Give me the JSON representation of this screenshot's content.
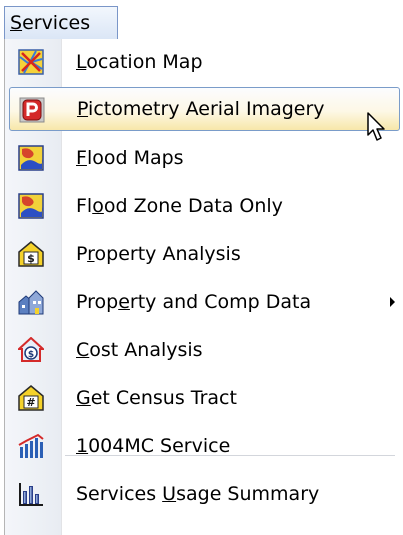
{
  "menubar": {
    "services_label": "Services",
    "mnemonic": "S",
    "rest": "ervices"
  },
  "menu": {
    "items": [
      {
        "id": "location-map",
        "label": "Location Map",
        "pre": "",
        "u": "L",
        "post": "ocation Map",
        "icon": "location-map-icon"
      },
      {
        "id": "pictometry",
        "label": "Pictometry Aerial Imagery",
        "pre": "",
        "u": "P",
        "post": "ictometry Aerial Imagery",
        "icon": "pictometry-p-icon",
        "highlighted": true
      },
      {
        "id": "flood-maps",
        "label": "Flood Maps",
        "pre": "",
        "u": "F",
        "post": "lood Maps",
        "icon": "flood-map-icon"
      },
      {
        "id": "flood-zone",
        "label": "Flood Zone Data Only",
        "pre": "Fl",
        "u": "o",
        "post": "od Zone Data Only",
        "icon": "flood-zone-icon"
      },
      {
        "id": "property-analysis",
        "label": "Property Analysis",
        "pre": "P",
        "u": "r",
        "post": "operty Analysis",
        "icon": "dollar-house-icon"
      },
      {
        "id": "property-comp",
        "label": "Property and Comp Data",
        "pre": "Prop",
        "u": "e",
        "post": "rty and Comp Data",
        "icon": "buildings-icon",
        "submenu": true
      },
      {
        "id": "cost-analysis",
        "label": "Cost Analysis",
        "pre": "",
        "u": "C",
        "post": "ost Analysis",
        "icon": "cost-house-icon"
      },
      {
        "id": "census-tract",
        "label": "Get Census Tract",
        "pre": "",
        "u": "G",
        "post": "et Census Tract",
        "icon": "census-house-icon"
      },
      {
        "id": "1004mc",
        "label": "1004MC Service",
        "pre": "",
        "u": "1",
        "post": "004MC Service",
        "icon": "market-chart-icon"
      },
      {
        "id": "usage-summary",
        "label": "Services Usage Summary",
        "pre": "Services ",
        "u": "U",
        "post": "sage Summary",
        "icon": "bar-chart-icon"
      }
    ]
  },
  "colors": {
    "highlight_border": "#7a9cc9",
    "highlight_fill": "#f7e7a9",
    "menubar_active": "#dbe6f6"
  }
}
